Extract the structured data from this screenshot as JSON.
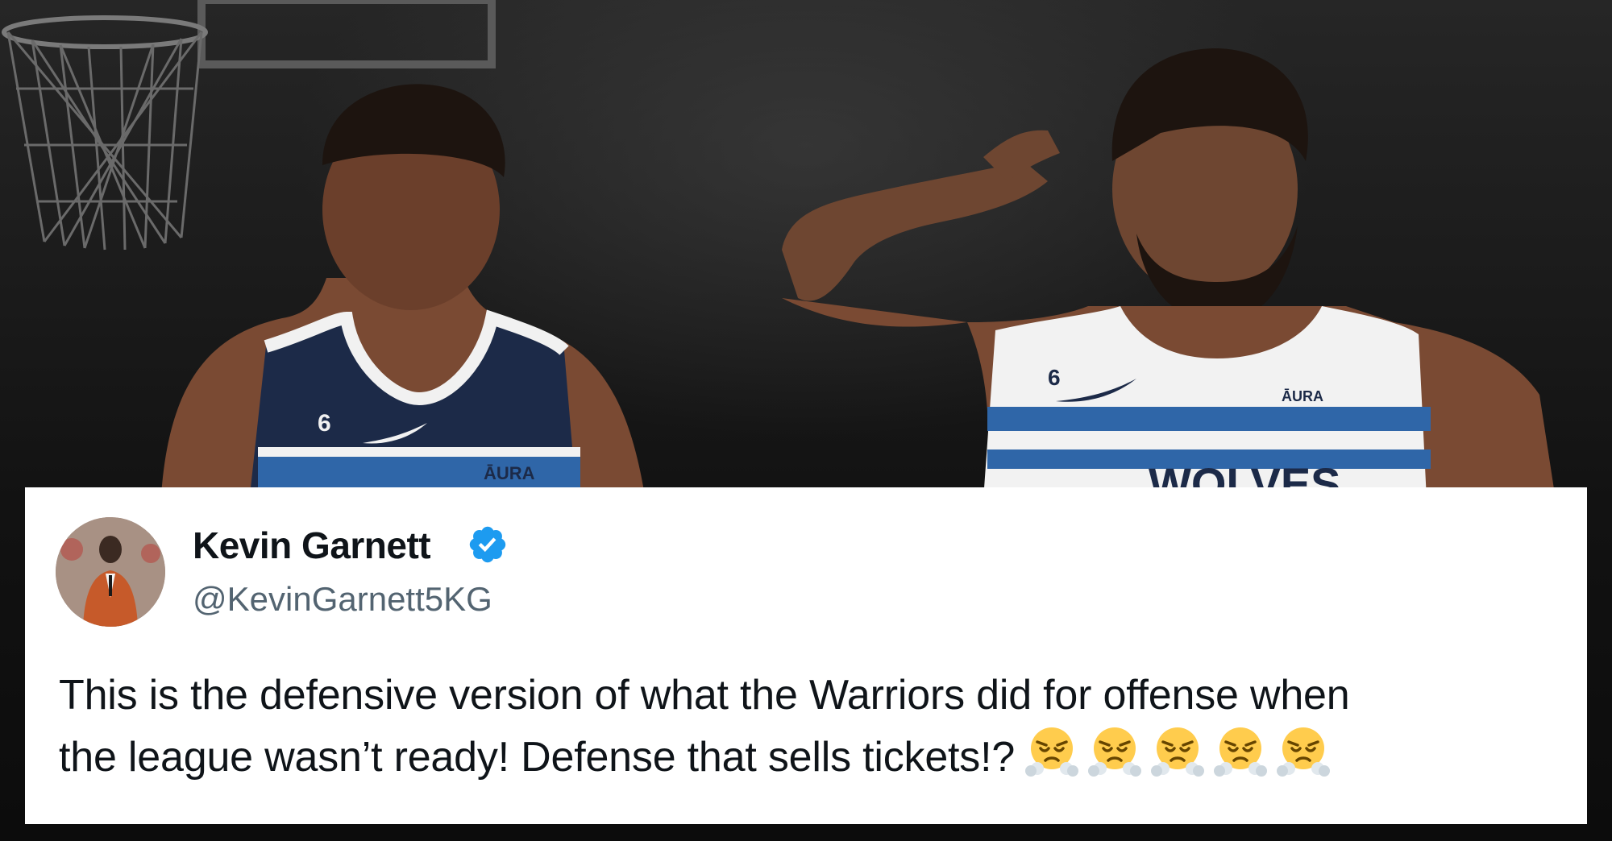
{
  "tweet": {
    "display_name": "Kevin Garnett",
    "handle": "@KevinGarnett5KG",
    "verified_icon": "verified-badge-icon",
    "text_line_1": "This is the defensive version of what the Warriors did for offense when",
    "text_line_2": "the league wasn’t ready! Defense that sells tickets!?",
    "emojis": [
      "face-with-steam-icon",
      "face-with-steam-icon",
      "face-with-steam-icon",
      "face-with-steam-icon",
      "face-with-steam-icon"
    ]
  },
  "background": {
    "left_jersey_number": "6",
    "right_jersey_number": "6",
    "left_sponsor": "ĀURA",
    "right_sponsor": "ĀURA",
    "right_jersey_wordmark": "WOLVES"
  },
  "colors": {
    "verified_blue": "#1d9bf0",
    "name_text": "#0f1419",
    "handle_text": "#536471",
    "jersey_navy": "#1c2a48",
    "jersey_stripe": "#2f66a8"
  }
}
